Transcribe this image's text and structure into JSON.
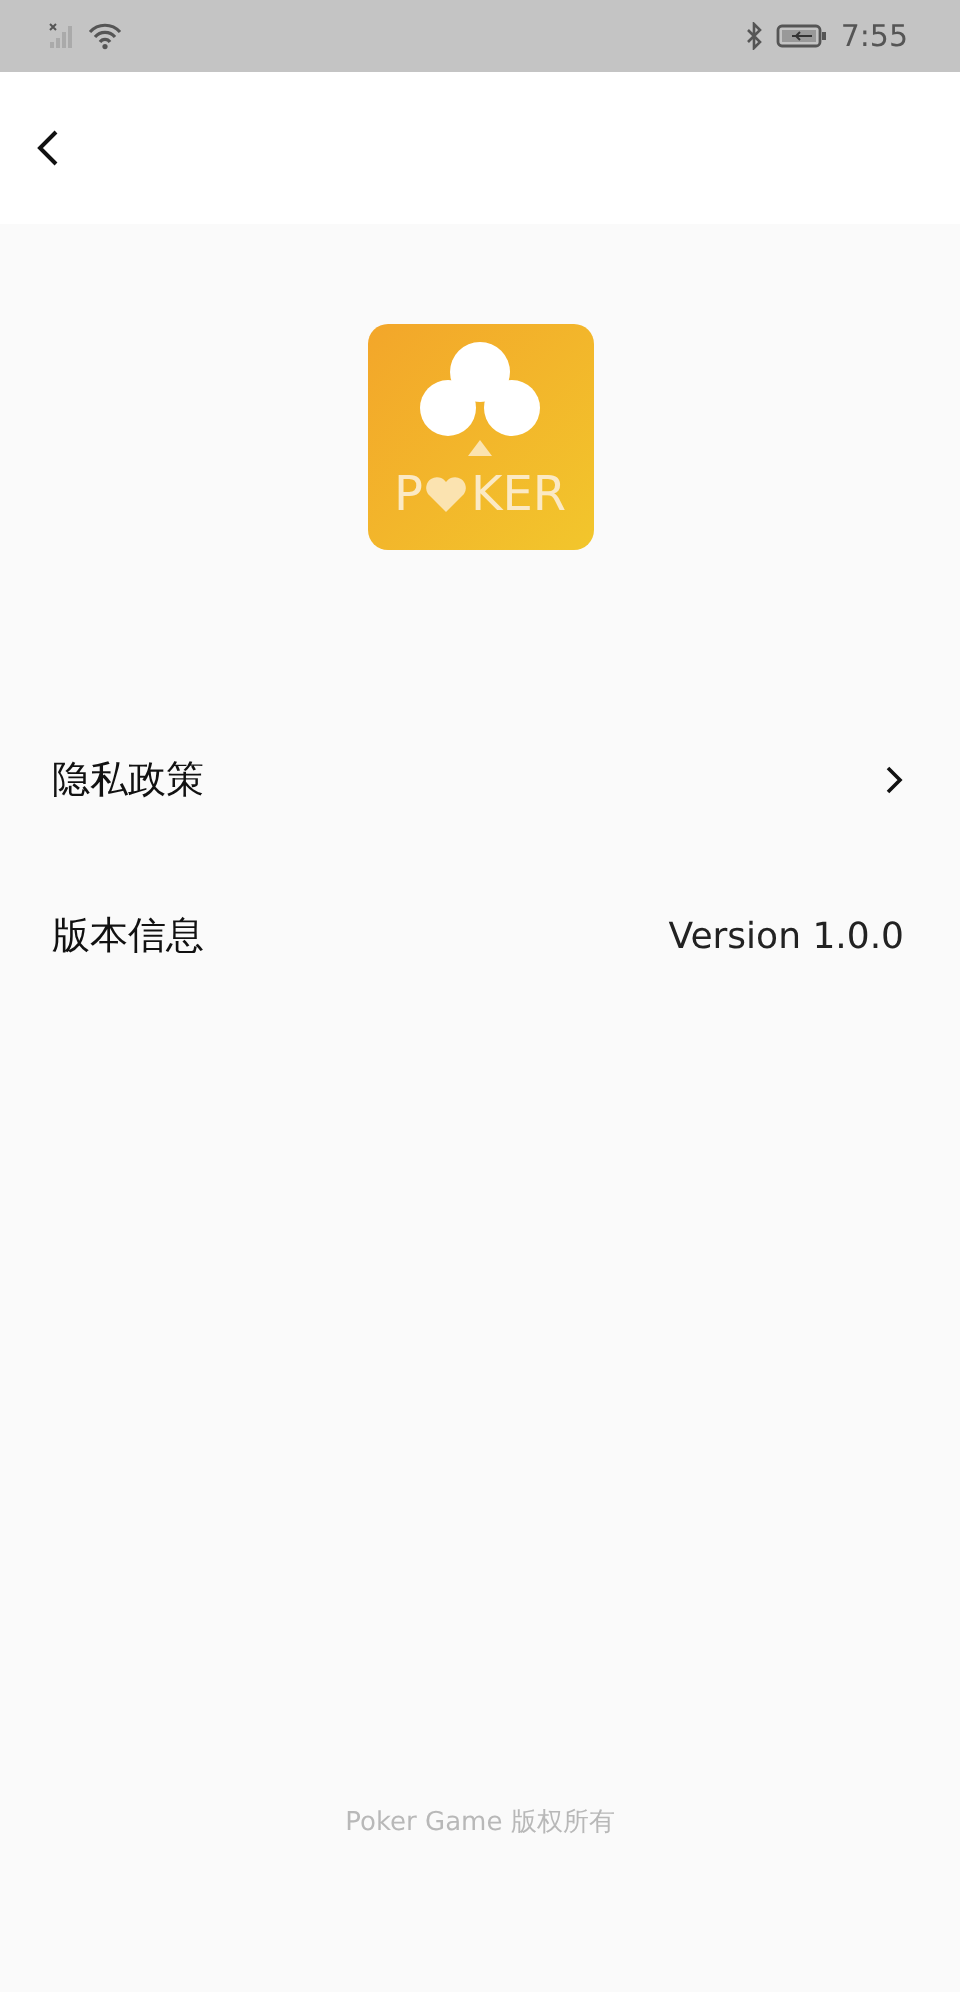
{
  "status_bar": {
    "time": "7:55"
  },
  "logo": {
    "text_before_heart": "P",
    "text_after_heart": "KER"
  },
  "settings": [
    {
      "kind": "link",
      "label": "隐私政策"
    },
    {
      "kind": "value",
      "label": "版本信息",
      "value": "Version 1.0.0"
    }
  ],
  "footer": "Poker Game 版权所有"
}
